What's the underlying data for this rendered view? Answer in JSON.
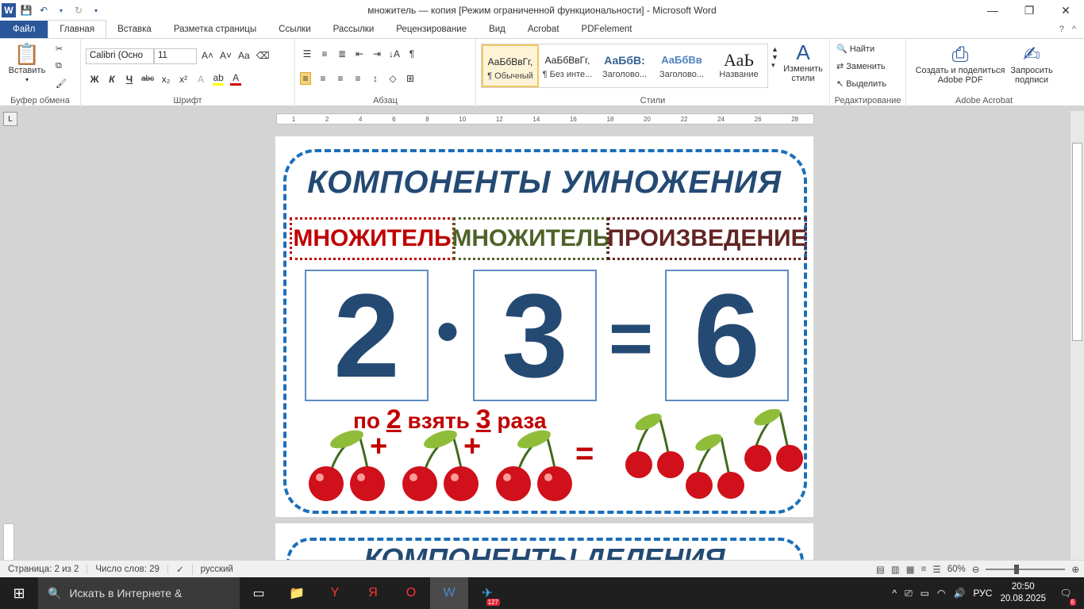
{
  "window": {
    "title": "множитель — копия [Режим ограниченной функциональности]  -  Microsoft Word",
    "app_logo": "W"
  },
  "tabs": [
    "Файл",
    "Главная",
    "Вставка",
    "Разметка страницы",
    "Ссылки",
    "Рассылки",
    "Рецензирование",
    "Вид",
    "Acrobat",
    "PDFelement"
  ],
  "ribbon": {
    "clipboard": {
      "paste_label": "Вставить",
      "group": "Буфер обмена"
    },
    "font": {
      "name": "Calibri (Осно",
      "size": "11",
      "group": "Шрифт",
      "bold": "Ж",
      "italic": "К",
      "underline": "Ч",
      "strike": "abc",
      "sub": "x₂",
      "sup": "x²",
      "case": "Aa"
    },
    "paragraph": {
      "group": "Абзац"
    },
    "styles": {
      "group": "Стили",
      "items": [
        {
          "preview": "АаБбВвГг,",
          "name": "¶ Обычный"
        },
        {
          "preview": "АаБбВвГг,",
          "name": "¶ Без инте..."
        },
        {
          "preview": "АаБбВ:",
          "name": "Заголово..."
        },
        {
          "preview": "АаБбВв",
          "name": "Заголово..."
        },
        {
          "preview": "АаЬ",
          "name": "Название"
        }
      ],
      "change_label": "Изменить стили"
    },
    "editing": {
      "group": "Редактирование",
      "find": "Найти",
      "replace": "Заменить",
      "select": "Выделить"
    },
    "acrobat": {
      "group": "Adobe Acrobat",
      "create": "Создать и поделиться Adobe PDF",
      "sign": "Запросить подписи"
    }
  },
  "ruler": {
    "ticks": [
      "1",
      "2",
      "4",
      "6",
      "8",
      "10",
      "12",
      "14",
      "16",
      "18",
      "20",
      "22",
      "24",
      "26",
      "28"
    ]
  },
  "document": {
    "title": "КОМПОНЕНТЫ УМНОЖЕНИЯ",
    "labels": [
      "МНОЖИТЕЛЬ",
      "МНОЖИТЕЛЬ",
      "ПРОИЗВЕДЕНИЕ"
    ],
    "numbers": [
      "2",
      "3",
      "6"
    ],
    "dot": "•",
    "equals": "=",
    "hint_pre": "по ",
    "hint_n1": "2",
    "hint_mid": " взять ",
    "hint_n2": "3",
    "hint_post": " раза",
    "plus": "+",
    "next_page_title": "КОМПОНЕНТЫ ДЕЛЕНИЯ"
  },
  "colors": {
    "title": "#244a73",
    "frame": "#1b6fba",
    "label1": "#c00000",
    "label2": "#4f6228",
    "label3": "#632523"
  },
  "status": {
    "page": "Страница: 2 из 2",
    "words": "Число слов: 29",
    "lang": "русский",
    "zoom": "60%"
  },
  "taskbar": {
    "search": "Искать в Интернете &",
    "lang": "РУС",
    "time": "20:50",
    "date": "20.08.2025",
    "telegram_badge": "127",
    "notifications": "6"
  }
}
